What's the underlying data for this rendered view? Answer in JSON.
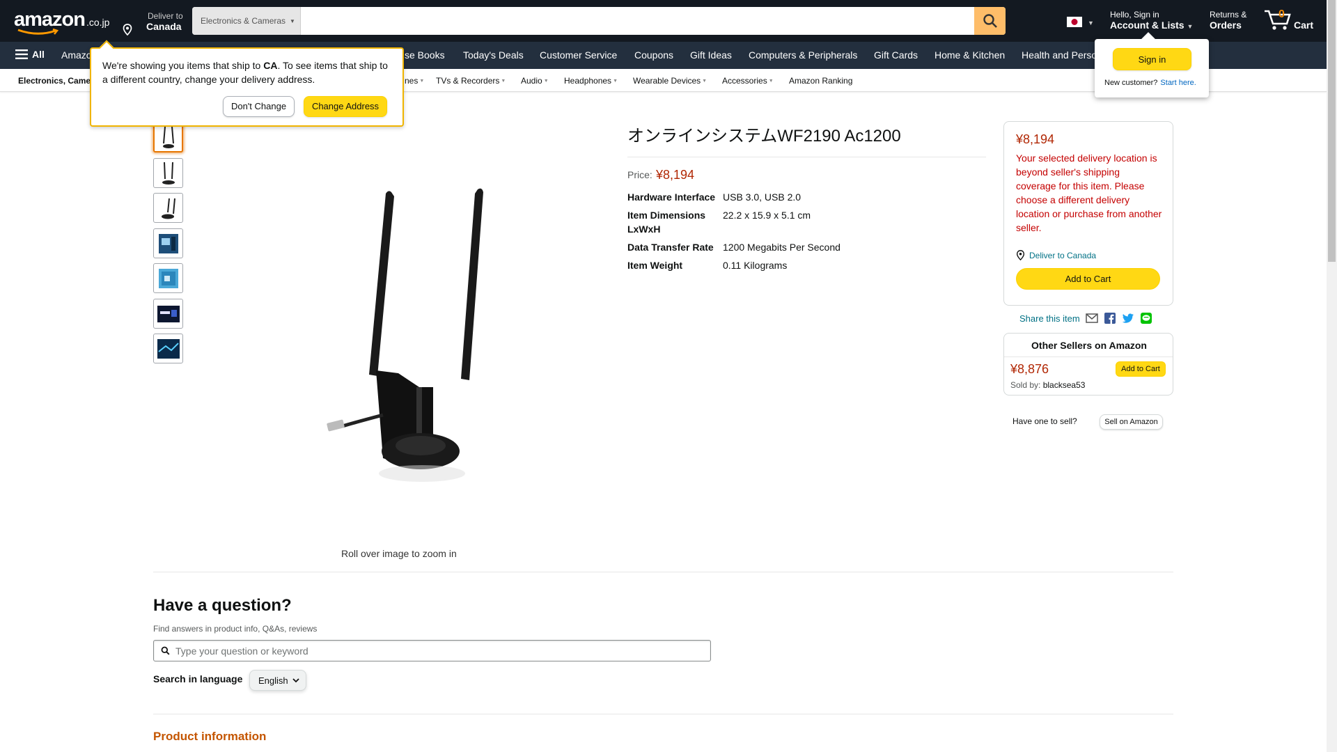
{
  "header": {
    "logo_text": "amazon",
    "logo_tld": ".co.jp",
    "deliver_line1": "Deliver to",
    "deliver_line2": "Canada",
    "search_category": "Electronics & Cameras",
    "search_placeholder": "",
    "account_line1": "Hello, Sign in",
    "account_line2": "Account & Lists",
    "returns_line1": "Returns &",
    "returns_line2": "Orders",
    "cart_count": "0",
    "cart_label": "Cart"
  },
  "nav": {
    "all_label": "All",
    "items": [
      "Amazon",
      "se Books",
      "Today's Deals",
      "Customer Service",
      "Coupons",
      "Gift Ideas",
      "Computers & Peripherals",
      "Gift Cards",
      "Home & Kitchen",
      "Health and Perso"
    ]
  },
  "subnav": {
    "items": [
      "Electronics, Came",
      "nes",
      "TVs & Recorders",
      "Audio",
      "Headphones",
      "Wearable Devices",
      "Accessories",
      "Amazon Ranking"
    ]
  },
  "ship_popover": {
    "text_a": "We're showing you items that ship to ",
    "country": "CA",
    "text_b": ". To see items that ship to a different country, change your delivery address.",
    "dont_change": "Don't Change",
    "change_address": "Change Address"
  },
  "signin_flyout": {
    "button": "Sign in",
    "new_customer": "New customer?",
    "start_here": "Start here."
  },
  "product": {
    "title": "オンラインシステムWF2190 Ac1200",
    "price_label": "Price:",
    "price": "¥8,194",
    "specs": [
      {
        "k1": "Hardware Interface",
        "k2": "",
        "v": "USB 3.0, USB 2.0"
      },
      {
        "k1": "Item Dimensions",
        "k2": "LxWxH",
        "v": "22.2 x 15.9 x 5.1 cm"
      },
      {
        "k1": "Data Transfer Rate",
        "k2": "",
        "v": "1200 Megabits Per Second"
      },
      {
        "k1": "Item Weight",
        "k2": "",
        "v": "0.11 Kilograms"
      }
    ],
    "rollover": "Roll over image to zoom in"
  },
  "buybox": {
    "price": "¥8,194",
    "message": "Your selected delivery location is beyond seller's shipping coverage for this item. Please choose a different delivery location or purchase from another seller.",
    "deliver": "Deliver to Canada",
    "add_to_cart": "Add to Cart",
    "share": "Share this item"
  },
  "sellers": {
    "title": "Other Sellers on Amazon",
    "price": "¥8,876",
    "add_to_cart": "Add to Cart",
    "sold_by_label": "Sold by: ",
    "sold_by": "blacksea53",
    "have_one": "Have one to sell?",
    "sell_button": "Sell on Amazon"
  },
  "qa": {
    "title": "Have a question?",
    "subtitle": "Find answers in product info, Q&As, reviews",
    "placeholder": "Type your question or keyword",
    "lang_label": "Search in language",
    "lang_value": "English"
  },
  "product_info_heading": "Product information",
  "colors": {
    "topbar": "#131921",
    "navbar": "#232f3e",
    "price": "#b12704",
    "accent_yellow": "#ffd814",
    "search_button": "#febd69",
    "link": "#007185"
  }
}
